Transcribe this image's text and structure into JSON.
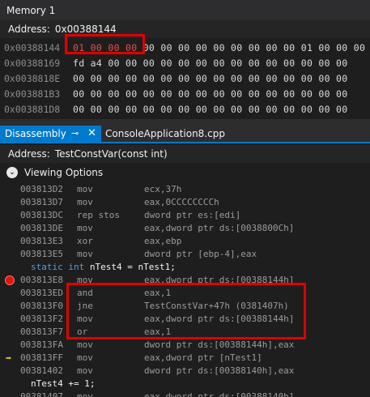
{
  "memory": {
    "title": "Memory 1",
    "address_label": "Address:",
    "address_value": "0x00388144",
    "rows": [
      {
        "addr": "0x00388144",
        "changed": "01 00 00 00",
        "rest": " 00 00 00 00 00 00 00 00 00 01 00 00 00 00"
      },
      {
        "addr": "0x00388169",
        "changed": "",
        "rest": "fd a4 00 00 00 00 00 00 00 00 00 00 00 00 00 00"
      },
      {
        "addr": "0x0038818E",
        "changed": "",
        "rest": "00 00 00 00 00 00 00 00 00 00 00 00 00 00 00 00"
      },
      {
        "addr": "0x003881B3",
        "changed": "",
        "rest": "00 00 00 00 00 00 00 00 00 00 00 00 00 00 00 00"
      },
      {
        "addr": "0x003881D8",
        "changed": "",
        "rest": "00 00 00 00 00 00 00 00 00 00 00 00 00 00 00 00"
      },
      {
        "addr": "0x003881FD",
        "changed": "",
        "rest": "00 00 00 00 00 00 00 00 00 00 00 00 00 00 00 00"
      }
    ]
  },
  "tabs": {
    "disassembly": "Disassembly",
    "pin_icon": "⊸",
    "close_icon": "✕",
    "source": "ConsoleApplication8.cpp"
  },
  "disasm": {
    "address_label": "Address:",
    "address_value": "TestConstVar(const int)",
    "viewing_options": "Viewing Options",
    "lines": [
      {
        "kind": "asm",
        "addr": "003813D2",
        "op": "mov",
        "args": "ecx,37h"
      },
      {
        "kind": "asm",
        "addr": "003813D7",
        "op": "mov",
        "args": "eax,0CCCCCCCCh"
      },
      {
        "kind": "asm",
        "addr": "003813DC",
        "op": "rep stos",
        "args": "dword ptr es:[edi]"
      },
      {
        "kind": "asm",
        "addr": "003813DE",
        "op": "mov",
        "args": "eax,dword ptr ds:[0038800Ch]"
      },
      {
        "kind": "asm",
        "addr": "003813E3",
        "op": "xor",
        "args": "eax,ebp"
      },
      {
        "kind": "asm",
        "addr": "003813E5",
        "op": "mov",
        "args": "dword ptr [ebp-4],eax"
      },
      {
        "kind": "src",
        "pre": "static int",
        "text": " nTest4 = nTest1;"
      },
      {
        "kind": "asm",
        "addr": "003813E8",
        "op": "mov",
        "args": "eax,dword ptr ds:[00388144h]",
        "marker": "breakpoint"
      },
      {
        "kind": "asm",
        "addr": "003813ED",
        "op": "and",
        "args": "eax,1"
      },
      {
        "kind": "asm",
        "addr": "003813F0",
        "op": "jne",
        "args": "TestConstVar+47h (0381407h)"
      },
      {
        "kind": "asm",
        "addr": "003813F2",
        "op": "mov",
        "args": "eax,dword ptr ds:[00388144h]"
      },
      {
        "kind": "asm",
        "addr": "003813F7",
        "op": "or",
        "args": "eax,1"
      },
      {
        "kind": "asm",
        "addr": "003813FA",
        "op": "mov",
        "args": "dword ptr ds:[00388144h],eax"
      },
      {
        "kind": "asm",
        "addr": "003813FF",
        "op": "mov",
        "args": "eax,dword ptr [nTest1]",
        "marker": "ip"
      },
      {
        "kind": "asm",
        "addr": "00381402",
        "op": "mov",
        "args": "dword ptr ds:[00388140h],eax"
      },
      {
        "kind": "src",
        "pre": "",
        "text": "nTest4 += 1;"
      },
      {
        "kind": "asm",
        "addr": "00381407",
        "op": "mov",
        "args": "eax,dword ptr ds:[00388140h]"
      }
    ]
  },
  "colors": {
    "accent": "#007acc",
    "highlight_box": "#e00000",
    "changed_bytes": "#f14c4c",
    "breakpoint": "#e51400",
    "ip_arrow": "#f5d300"
  }
}
